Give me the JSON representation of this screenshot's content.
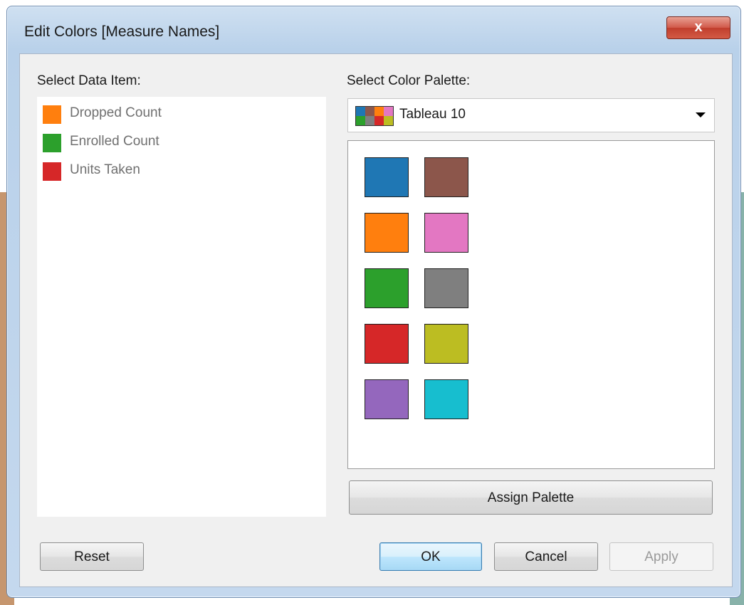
{
  "window": {
    "title": "Edit Colors [Measure Names]",
    "close_glyph": "x"
  },
  "left_panel": {
    "label": "Select Data Item:",
    "items": [
      {
        "label": "Dropped Count",
        "color": "#ff7f0e"
      },
      {
        "label": "Enrolled Count",
        "color": "#2ca02c"
      },
      {
        "label": "Units Taken",
        "color": "#d62728"
      }
    ]
  },
  "right_panel": {
    "label": "Select Color Palette:",
    "palette_select": {
      "selected": "Tableau 10",
      "icon": "palette-preview-icon"
    },
    "palette_colors": [
      "#1f77b4",
      "#8c564b",
      "#ff7f0e",
      "#e377c2",
      "#2ca02c",
      "#7f7f7f",
      "#d62728",
      "#bcbd22",
      "#9467bd",
      "#17becf"
    ],
    "assign_label": "Assign Palette"
  },
  "footer": {
    "reset_label": "Reset",
    "ok_label": "OK",
    "cancel_label": "Cancel",
    "apply_label": "Apply"
  }
}
